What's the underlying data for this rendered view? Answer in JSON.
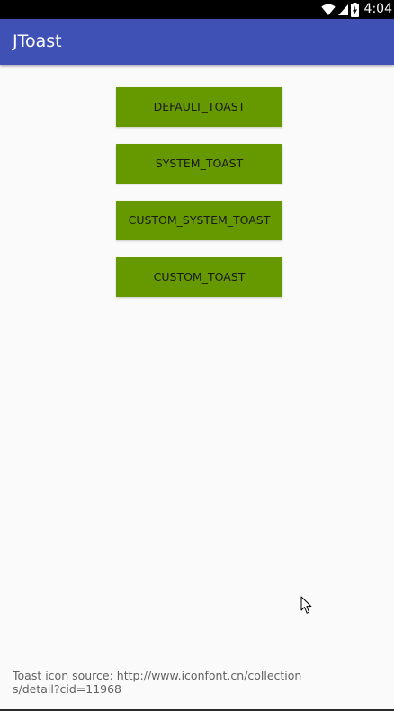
{
  "status_bar": {
    "time": "4:04",
    "icons": [
      "wifi-icon",
      "cell-signal-icon",
      "battery-charging-icon"
    ]
  },
  "app_bar": {
    "title": "JToast",
    "color": "#3f51b5"
  },
  "buttons": [
    {
      "label": "DEFAULT_TOAST"
    },
    {
      "label": "SYSTEM_TOAST"
    },
    {
      "label": "CUSTOM_SYSTEM_TOAST"
    },
    {
      "label": "CUSTOM_TOAST"
    }
  ],
  "button_color": "#669900",
  "footer": {
    "text": "Toast icon source: http://www.iconfont.cn/collections/detail?cid=11968"
  }
}
